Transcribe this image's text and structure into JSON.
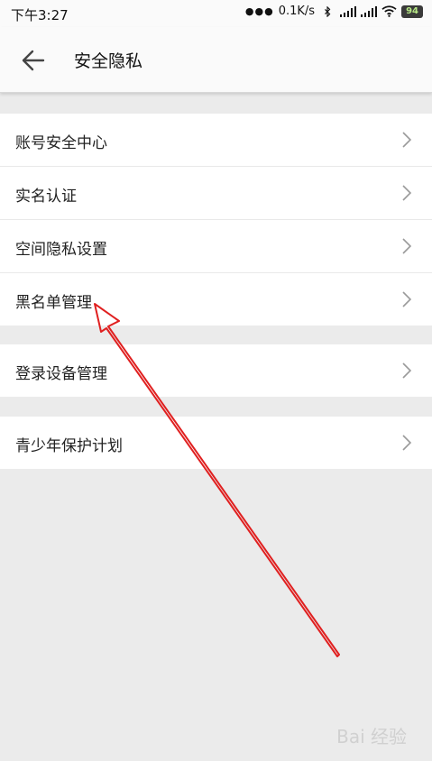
{
  "status_bar": {
    "time": "下午3:27",
    "network_speed": "0.1K/s",
    "battery": "94"
  },
  "header": {
    "title": "安全隐私"
  },
  "groups": [
    {
      "items": [
        {
          "label": "账号安全中心"
        },
        {
          "label": "实名认证"
        },
        {
          "label": "空间隐私设置"
        },
        {
          "label": "黑名单管理"
        }
      ]
    },
    {
      "items": [
        {
          "label": "登录设备管理"
        }
      ]
    },
    {
      "items": [
        {
          "label": "青少年保护计划"
        }
      ]
    }
  ],
  "watermark": "Bai 经验",
  "colors": {
    "background": "#ebebeb",
    "annotation_arrow": "#e02020"
  }
}
